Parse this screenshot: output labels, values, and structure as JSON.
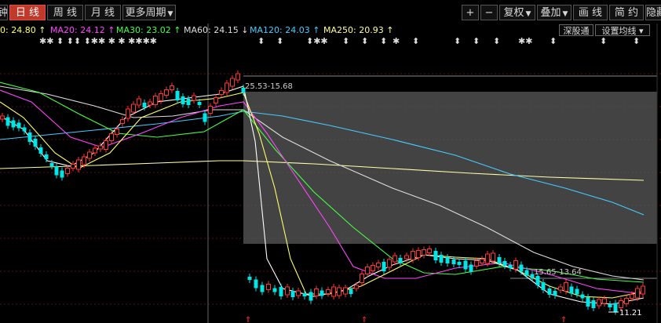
{
  "toolbar": {
    "left_tabs": [
      {
        "label": "钟",
        "active": false
      },
      {
        "label": "日 线",
        "active": true
      },
      {
        "label": "周 线",
        "active": false
      },
      {
        "label": "月 线",
        "active": false
      },
      {
        "label": "更多周期",
        "active": false,
        "dropdown": true
      }
    ],
    "right_buttons": [
      {
        "label": "+"
      },
      {
        "label": "−"
      },
      {
        "label": "复权",
        "dropdown": true
      },
      {
        "label": "叠加",
        "dropdown": true
      },
      {
        "label": "画 线"
      },
      {
        "label": "简 约"
      },
      {
        "label": "隐藏"
      }
    ]
  },
  "ma_legend": [
    {
      "label": "0: 24.80",
      "color": "#ffff66",
      "arrow": "↑"
    },
    {
      "label": "MA20: 24.12",
      "color": "#ff44ff",
      "arrow": "↑"
    },
    {
      "label": "MA30: 23.02",
      "color": "#44ff44",
      "arrow": "↑"
    },
    {
      "label": "MA60: 24.15",
      "color": "#dddddd",
      "arrow": "↓"
    },
    {
      "label": "MA120: 24.03",
      "color": "#44ccff",
      "arrow": "↑"
    },
    {
      "label": "MA250: 20.93",
      "color": "#ffff99",
      "arrow": "↑"
    }
  ],
  "right_controls": {
    "exchange": "深股通",
    "ma_settings": "设置均线",
    "ma_settings_arrow": "▾"
  },
  "annotations": {
    "range_label": "25.53-15.68",
    "range_label_2": "15.65-13.64",
    "low_label": "11.21"
  },
  "event_markers": "✱✱  ⬍ ⬍⬍ ⬍✱✱ ✱ ✱ ✱✱✱✱",
  "colors": {
    "up": "#ff3333",
    "down": "#00e5e5",
    "highlight": "#e03a2a",
    "background": "#000000",
    "grid": "#7a1a1a"
  },
  "chart_data": {
    "type": "candlestick",
    "price_range": [
      11.21,
      25.53
    ],
    "range_box": {
      "high": 25.53,
      "low": 15.68
    }
  }
}
